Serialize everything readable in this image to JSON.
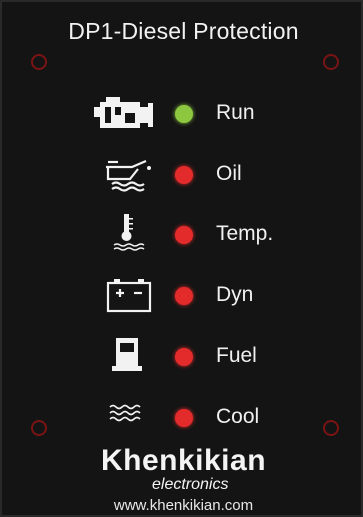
{
  "panel": {
    "title": "DP1-Diesel Protection",
    "background": "#141414",
    "indicators": [
      {
        "label": "Run",
        "icon": "engine-icon",
        "led_color": "#8dc63f"
      },
      {
        "label": "Oil",
        "icon": "oil-can-icon",
        "led_color": "#e42b2b"
      },
      {
        "label": "Temp.",
        "icon": "thermometer-icon",
        "led_color": "#e42b2b"
      },
      {
        "label": "Dyn",
        "icon": "battery-icon",
        "led_color": "#e42b2b"
      },
      {
        "label": "Fuel",
        "icon": "fuel-pump-icon",
        "led_color": "#e42b2b"
      },
      {
        "label": "Cool",
        "icon": "coolant-icon",
        "led_color": "#e42b2b"
      }
    ]
  },
  "brand": {
    "name": "Khenkikian",
    "sub": "electronics",
    "url": "www.khenkikian.com"
  }
}
